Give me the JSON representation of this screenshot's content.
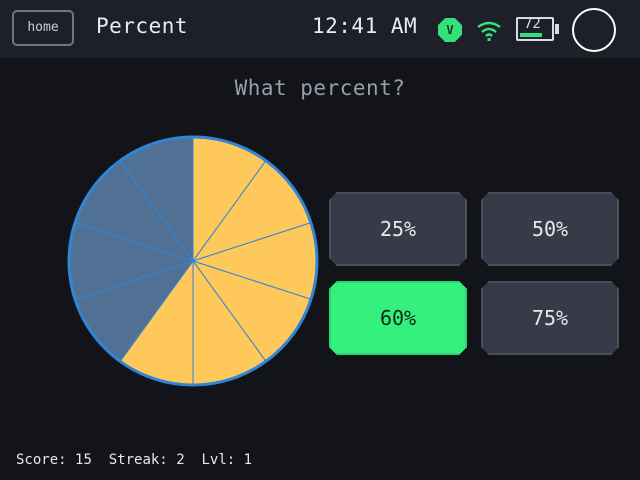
{
  "header": {
    "home_label": "home",
    "title": "Percent",
    "time": "12:41 AM",
    "badge_letter": "V",
    "battery_level": "72"
  },
  "question": "What percent?",
  "chart_data": {
    "type": "pie",
    "slices_total": 10,
    "slices_filled": 6,
    "percent_filled": 60,
    "filled_color": "#fec85a",
    "empty_color": "#507193",
    "line_color": "#2f86d6"
  },
  "answers": [
    {
      "label": "25%",
      "selected": false
    },
    {
      "label": "50%",
      "selected": false
    },
    {
      "label": "60%",
      "selected": true
    },
    {
      "label": "75%",
      "selected": false
    }
  ],
  "stats": {
    "score_label": "Score:",
    "score": "15",
    "streak_label": "Streak:",
    "streak": "2",
    "level_label": "Lvl:",
    "level": "1"
  },
  "colors": {
    "accent_green": "#34f07d",
    "header_bg": "#1d2029",
    "background": "#12141a"
  }
}
